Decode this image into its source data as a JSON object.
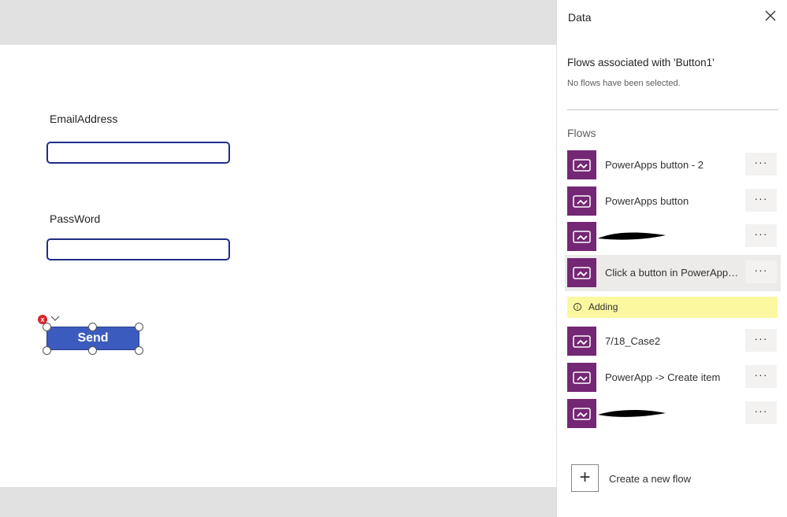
{
  "canvas": {
    "email_label": "EmailAddress",
    "email_value": "",
    "password_label": "PassWord",
    "password_value": "",
    "send_label": "Send",
    "error_icon": "x"
  },
  "panel": {
    "title": "Data",
    "associated_heading": "Flows associated with 'Button1'",
    "no_flows_text": "No flows have been selected.",
    "flows_heading": "Flows",
    "flows": [
      {
        "name": "PowerApps button - 2",
        "more": "···"
      },
      {
        "name": "PowerApps button",
        "more": "···"
      },
      {
        "name": "",
        "more": "···",
        "redacted": true
      },
      {
        "name": "Click a button in PowerApps...",
        "more": "···",
        "selected": true
      },
      {
        "name": "7/18_Case2",
        "more": "···"
      },
      {
        "name": "PowerApp -> Create item",
        "more": "···"
      },
      {
        "name": "",
        "more": "···",
        "redacted": true
      }
    ],
    "adding_status": "Adding",
    "adding_icon": "i",
    "create_flow_label": "Create a new flow",
    "create_flow_icon": "+"
  },
  "colors": {
    "flow_icon_bg": "#742774",
    "send_button_bg": "#3b5bbf",
    "adding_bg": "#fbf8a0"
  }
}
